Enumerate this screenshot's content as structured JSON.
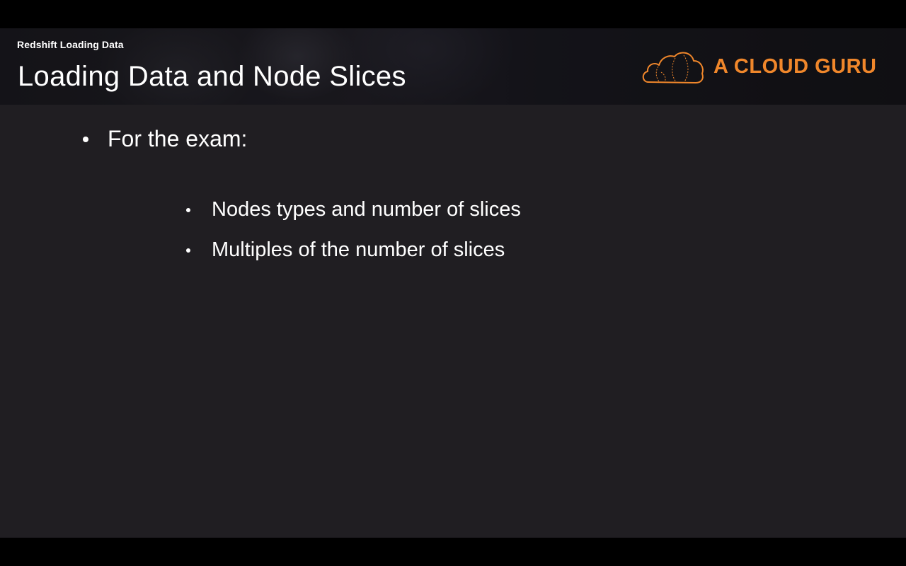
{
  "header": {
    "section_label": "Redshift Loading Data",
    "title": "Loading Data and Node Slices",
    "logo": {
      "icon": "cloud-icon",
      "text": "A CLOUD GURU",
      "color": "#f0872b"
    }
  },
  "content": {
    "bullet": "For the exam:",
    "sub_bullets": [
      "Nodes types and number of slices",
      "Multiples of the number of slices"
    ]
  },
  "colors": {
    "background": "#201e22",
    "text": "#ffffff",
    "accent": "#f0872b"
  }
}
